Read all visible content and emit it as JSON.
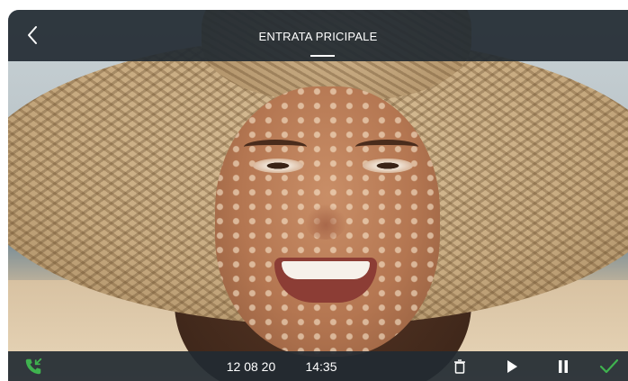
{
  "header": {
    "title": "ENTRATA PRICIPALE",
    "back_icon": "chevron-left-icon"
  },
  "footer": {
    "date": "12 08 20",
    "time": "14:35",
    "icons": [
      "phone-incoming-icon",
      "trash-icon",
      "play-icon",
      "pause-icon",
      "check-icon"
    ]
  },
  "colors": {
    "bar_background": "#222a32",
    "accent_green": "#3fb34f",
    "text": "#ffffff"
  }
}
